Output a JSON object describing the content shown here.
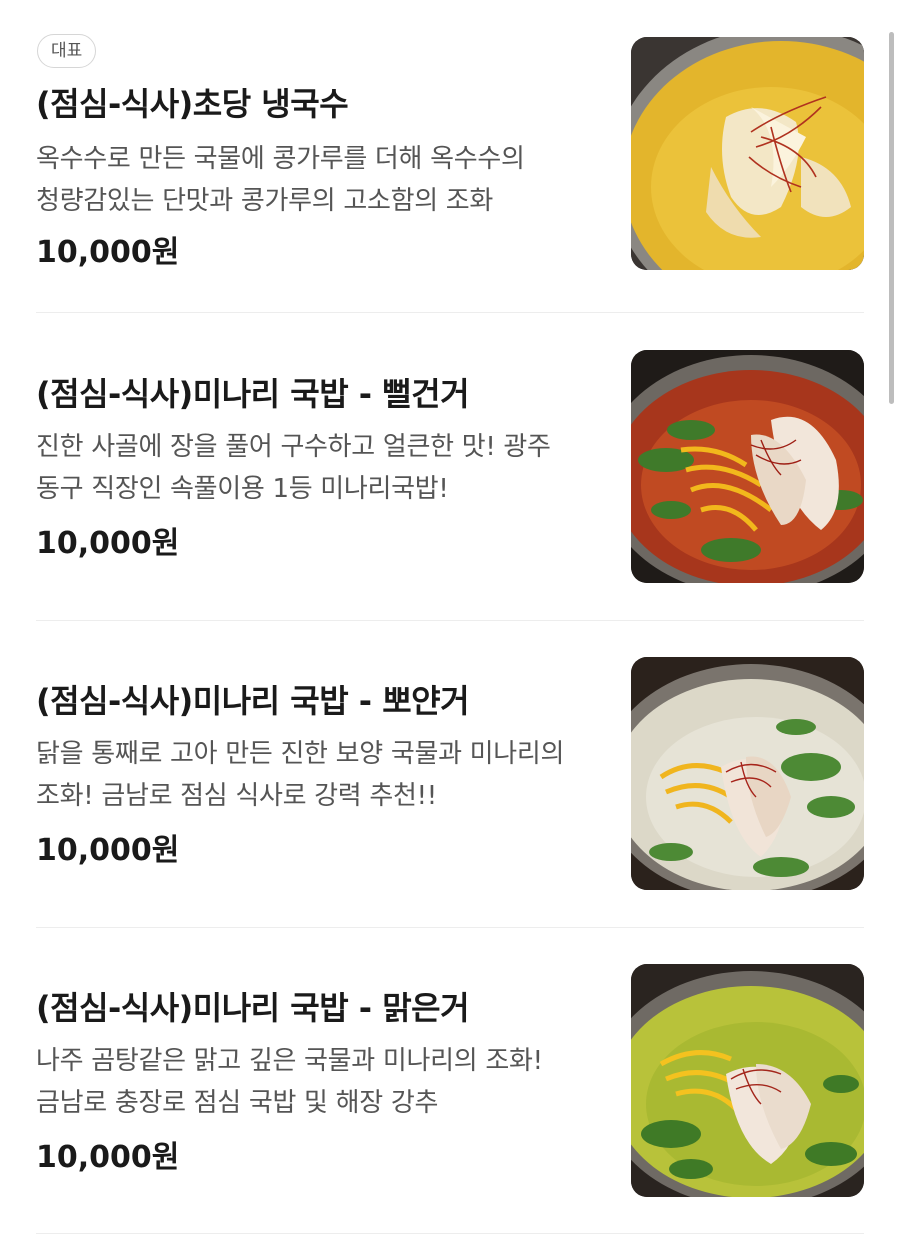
{
  "badge": "대표",
  "items": [
    {
      "name": "(점심-식사)초당 냉국수",
      "description": "옥수수로 만든 국물에 콩가루를 더해 옥수수의 청량감있는 단맛과 콩가루의 고소함의 조화",
      "price": "10,000원",
      "image": "corn-cold-noodle-image"
    },
    {
      "name": "(점심-식사)미나리 국밥 - 뻘건거",
      "description": "진한 사골에 장을 풀어 구수하고 얼큰한 맛! 광주 동구 직장인 속풀이용 1등 미나리국밥!",
      "price": "10,000원",
      "image": "red-minari-gukbap-image"
    },
    {
      "name": "(점심-식사)미나리 국밥 - 뽀얀거",
      "description": "닭을 통째로 고아 만든 진한 보양 국물과 미나리의 조화! 금남로 점심 식사로 강력 추천!!",
      "price": "10,000원",
      "image": "white-minari-gukbap-image"
    },
    {
      "name": "(점심-식사)미나리 국밥 - 맑은거",
      "description": "나주 곰탕같은 맑고 깊은 국물과 미나리의 조화!금남로 충장로 점심 국밥 및 해장 강추",
      "price": "10,000원",
      "image": "clear-minari-gukbap-image"
    }
  ]
}
